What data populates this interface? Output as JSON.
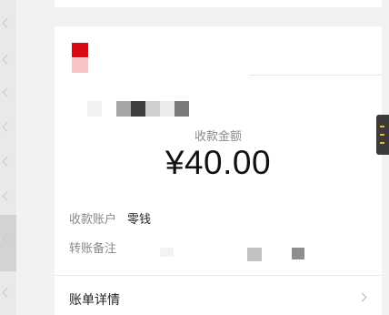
{
  "receipt": {
    "amount_label": "收款金额",
    "amount": "¥40.00",
    "account_label": "收款账户",
    "account_value": "零钱",
    "remark_label": "转账备注"
  },
  "footer": {
    "detail_label": "账单详情"
  },
  "colors": {
    "brand_red": "#d90a16",
    "brand_red_light": "#f6c4c4",
    "tool_accent": "#e9b23d"
  },
  "icons": {
    "logo": "merchant-logo",
    "detail_arrow": "chevron-right-icon"
  }
}
